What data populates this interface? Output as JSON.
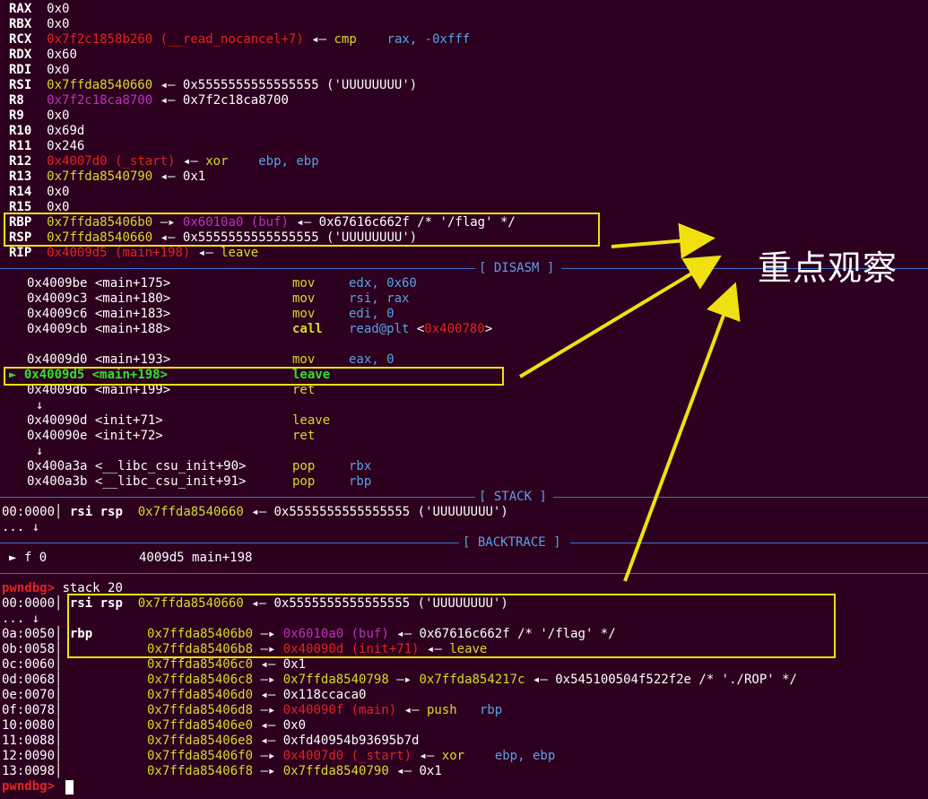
{
  "registers": [
    {
      "name": "RAX",
      "val": "0x0"
    },
    {
      "name": "RBX",
      "val": "0x0"
    },
    {
      "name": "RCX",
      "addr": "0x7f2c1858b260",
      "sym": "(__read_nocancel+7)",
      "arrow": "◂—",
      "mn": "cmp",
      "ops": "rax, -0xfff"
    },
    {
      "name": "RDX",
      "val": "0x60"
    },
    {
      "name": "RDI",
      "val": "0x0"
    },
    {
      "name": "RSI",
      "addr": "0x7ffda8540660",
      "arrow": "◂—",
      "rest": "0x5555555555555555 ('UUUUUUUU')"
    },
    {
      "name": "R8",
      "addr": "0x7f2c18ca8700",
      "arrow": "◂—",
      "rest": "0x7f2c18ca8700"
    },
    {
      "name": "R9",
      "val": "0x0"
    },
    {
      "name": "R10",
      "val": "0x69d"
    },
    {
      "name": "R11",
      "val": "0x246"
    },
    {
      "name": "R12",
      "addr": "0x4007d0",
      "sym": "(_start)",
      "arrow": "◂—",
      "mn": "xor",
      "ops": "ebp, ebp"
    },
    {
      "name": "R13",
      "addr": "0x7ffda8540790",
      "arrow": "◂—",
      "rest": "0x1"
    },
    {
      "name": "R14",
      "val": "0x0"
    },
    {
      "name": "R15",
      "val": "0x0"
    },
    {
      "name": "RBP",
      "addr": "0x7ffda85406b0",
      "arrow1": "—▸",
      "addr2": "0x6010a0",
      "sym2": "(buf)",
      "arrow": "◂—",
      "rest": "0x67616c662f /* '/flag' */"
    },
    {
      "name": "RSP",
      "addr": "0x7ffda8540660",
      "arrow": "◂—",
      "rest": "0x5555555555555555 ('UUUUUUUU')"
    },
    {
      "name": "RIP",
      "addr": "0x4009d5",
      "sym": "(main+198)",
      "arrow": "◂—",
      "mn": "leave"
    }
  ],
  "sections": {
    "disasm": "[ DISASM ]",
    "stack": "[ STACK ]",
    "backtrace": "[ BACKTRACE ]"
  },
  "disasm": [
    {
      "addr": "0x4009be",
      "sym": "<main+175>",
      "mn": "mov",
      "ops": "edx, 0x60"
    },
    {
      "addr": "0x4009c3",
      "sym": "<main+180>",
      "mn": "mov",
      "ops": "rsi, rax"
    },
    {
      "addr": "0x4009c6",
      "sym": "<main+183>",
      "mn": "mov",
      "ops": "edi, 0"
    },
    {
      "addr": "0x4009cb",
      "sym": "<main+188>",
      "mn": "call",
      "ops": "read@plt",
      "target": "0x400780"
    },
    {
      "addr": "0x4009d0",
      "sym": "<main+193>",
      "mn": "mov",
      "ops": "eax, 0"
    },
    {
      "addr": "0x4009d5",
      "sym": "<main+198>",
      "mn": "leave",
      "ops": "",
      "current": "►"
    },
    {
      "addr": "0x4009d6",
      "sym": "<main+199>",
      "mn": "ret",
      "ops": ""
    },
    {
      "addr": "0x40090d",
      "sym": "<init+71>",
      "mn": "leave",
      "ops": ""
    },
    {
      "addr": "0x40090e",
      "sym": "<init+72>",
      "mn": "ret",
      "ops": ""
    },
    {
      "addr": "0x400a3a",
      "sym": "<__libc_csu_init+90>",
      "mn": "pop",
      "ops": "rbx"
    },
    {
      "addr": "0x400a3b",
      "sym": "<__libc_csu_init+91>",
      "mn": "pop",
      "ops": "rbp"
    }
  ],
  "down_arrow": "↓",
  "stack": {
    "off": "00:0000",
    "regs": "rsi rsp",
    "addr": "0x7ffda8540660",
    "arrow": "◂—",
    "rest": "0x5555555555555555 ('UUUUUUUU')",
    "ellipsis": "..."
  },
  "backtrace": {
    "marker": "►",
    "frame": "f 0",
    "addr": "4009d5",
    "sym": "main+198"
  },
  "prompt": "pwndbg>",
  "command": "stack 20",
  "stack20": [
    {
      "off": "00:0000",
      "regs": "rsi rsp",
      "addr": "0x7ffda8540660",
      "arrow": "◂—",
      "rest": "0x5555555555555555 ('UUUUUUUU')"
    },
    {
      "off": "0a:0050",
      "regs": "rbp",
      "addr": "0x7ffda85406b0",
      "a1": "—▸",
      "addr2": "0x6010a0",
      "sym2": "(buf)",
      "arrow": "◂—",
      "rest": "0x67616c662f /* '/flag' */"
    },
    {
      "off": "0b:0058",
      "addr": "0x7ffda85406b8",
      "a1": "—▸",
      "addr2": "0x40090d",
      "sym2": "(init+71)",
      "arrow": "◂—",
      "mn": "leave"
    },
    {
      "off": "0c:0060",
      "addr": "0x7ffda85406c0",
      "arrow": "◂—",
      "rest": "0x1"
    },
    {
      "off": "0d:0068",
      "addr": "0x7ffda85406c8",
      "a1": "—▸",
      "addr2": "0x7ffda8540798",
      "a2": "—▸",
      "addr3": "0x7ffda854217c",
      "arrow": "◂—",
      "rest": "0x545100504f522f2e /* './ROP' */"
    },
    {
      "off": "0e:0070",
      "addr": "0x7ffda85406d0",
      "arrow": "◂—",
      "rest": "0x118ccaca0"
    },
    {
      "off": "0f:0078",
      "addr": "0x7ffda85406d8",
      "a1": "—▸",
      "addr2": "0x40090f",
      "sym2": "(main)",
      "arrow": "◂—",
      "mn": "push",
      "ops": "rbp"
    },
    {
      "off": "10:0080",
      "addr": "0x7ffda85406e0",
      "arrow": "◂—",
      "rest": "0x0"
    },
    {
      "off": "11:0088",
      "addr": "0x7ffda85406e8",
      "arrow": "◂—",
      "rest": "0xfd40954b93695b7d"
    },
    {
      "off": "12:0090",
      "addr": "0x7ffda85406f0",
      "a1": "—▸",
      "addr2": "0x4007d0",
      "sym2": "(_start)",
      "arrow": "◂—",
      "mn": "xor",
      "ops": "ebp, ebp"
    },
    {
      "off": "13:0098",
      "addr": "0x7ffda85406f8",
      "a1": "—▸",
      "addr2": "0x7ffda8540790",
      "arrow": "◂—",
      "rest": "0x1"
    }
  ],
  "annotation": "重点观察",
  "colors": {
    "bg": "#2c001e",
    "highlight": "#f0e010",
    "rule": "#3f6fd0"
  }
}
